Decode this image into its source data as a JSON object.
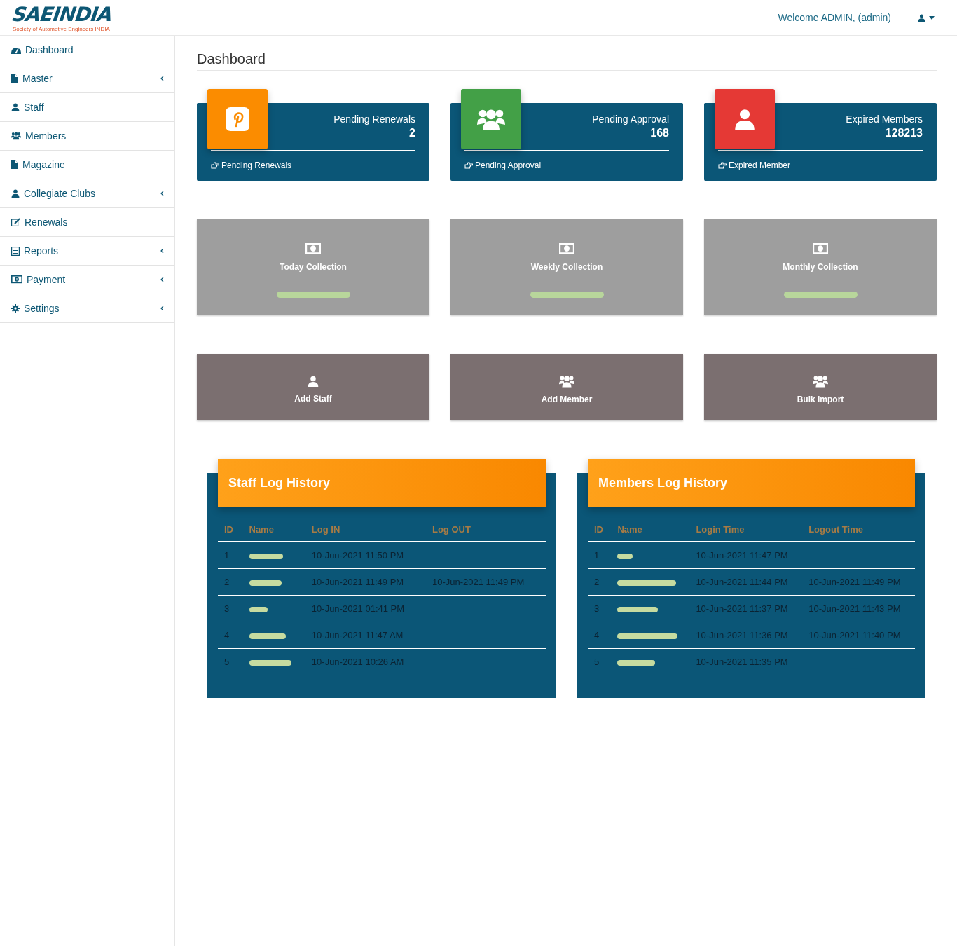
{
  "header": {
    "logo_text": "SAEINDIA",
    "logo_subtitle": "Society of Automotive Engineers INDIA",
    "welcome": "Welcome ADMIN, (admin)"
  },
  "sidebar": {
    "items": [
      {
        "label": "Dashboard",
        "has_submenu": false
      },
      {
        "label": "Master",
        "has_submenu": true
      },
      {
        "label": "Staff",
        "has_submenu": false
      },
      {
        "label": "Members",
        "has_submenu": false
      },
      {
        "label": "Magazine",
        "has_submenu": false
      },
      {
        "label": "Collegiate Clubs",
        "has_submenu": true
      },
      {
        "label": "Renewals",
        "has_submenu": false
      },
      {
        "label": "Reports",
        "has_submenu": true
      },
      {
        "label": "Payment",
        "has_submenu": true
      },
      {
        "label": "Settings",
        "has_submenu": true
      }
    ]
  },
  "page_title": "Dashboard",
  "stat_cards": [
    {
      "title": "Pending Renewals",
      "value": "2",
      "link": "Pending Renewals",
      "color": "#fb8c00"
    },
    {
      "title": "Pending Approval",
      "value": "168",
      "link": "Pending Approval",
      "color": "#43a047"
    },
    {
      "title": "Expired Members",
      "value": "128213",
      "link": "Expired Member",
      "color": "#e53935"
    }
  ],
  "collection_cards": [
    {
      "title": "Today Collection"
    },
    {
      "title": "Weekly Collection"
    },
    {
      "title": "Monthly Collection"
    }
  ],
  "action_cards": [
    {
      "label": "Add Staff"
    },
    {
      "label": "Add Member"
    },
    {
      "label": "Bulk Import"
    }
  ],
  "log_panels": [
    {
      "title": "Staff Log History",
      "columns": [
        "ID",
        "Name",
        "Log IN",
        "Log OUT"
      ],
      "rows": [
        {
          "id": "1",
          "time_in": "10-Jun-2021 11:50 PM"
        },
        {
          "id": "2",
          "time_in": "10-Jun-2021 11:49 PM",
          "time_out": "10-Jun-2021 11:49 PM"
        },
        {
          "id": "3",
          "time_in": "10-Jun-2021 01:41 PM"
        },
        {
          "id": "4",
          "time_in": "10-Jun-2021 11:47 AM"
        },
        {
          "id": "5",
          "time_in": "10-Jun-2021 10:26 AM"
        }
      ]
    },
    {
      "title": "Members Log History",
      "columns": [
        "ID",
        "Name",
        "Login Time",
        "Logout Time"
      ],
      "rows": [
        {
          "id": "1",
          "time_in": "10-Jun-2021 11:47 PM"
        },
        {
          "id": "2",
          "time_in": "10-Jun-2021 11:44 PM",
          "time_out": "10-Jun-2021 11:49 PM"
        },
        {
          "id": "3",
          "time_in": "10-Jun-2021 11:37 PM",
          "time_out": "10-Jun-2021 11:43 PM"
        },
        {
          "id": "4",
          "time_in": "10-Jun-2021 11:36 PM",
          "time_out": "10-Jun-2021 11:40 PM"
        },
        {
          "id": "5",
          "time_in": "10-Jun-2021 11:35 PM"
        }
      ]
    }
  ]
}
